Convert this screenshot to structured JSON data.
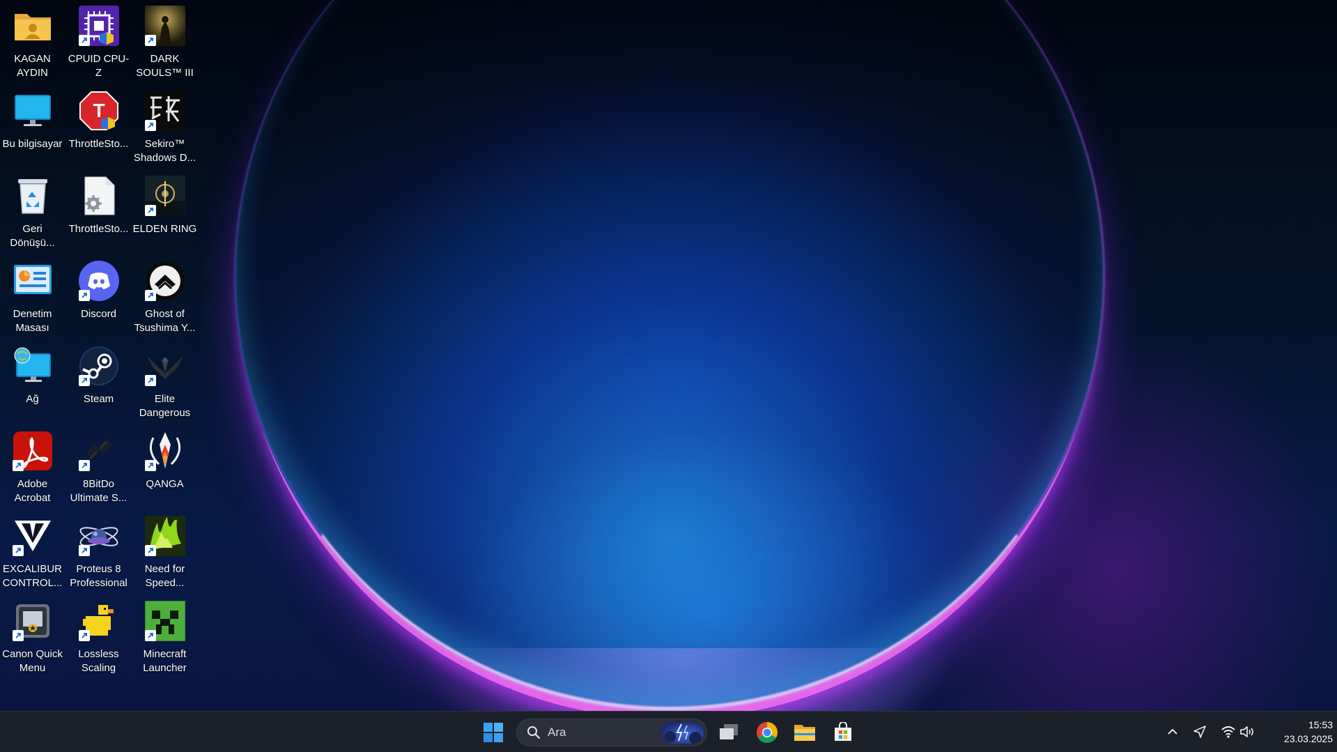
{
  "desktop": {
    "icons": [
      {
        "label": "KAGAN\nAYDIN",
        "icon": "user-folder-icon"
      },
      {
        "label": "Bu bilgisayar",
        "icon": "computer-icon"
      },
      {
        "label": "Geri\nDönüşü...",
        "icon": "recycle-bin-icon"
      },
      {
        "label": "Denetim\nMasası",
        "icon": "control-panel-icon"
      },
      {
        "label": "Ağ",
        "icon": "network-icon"
      },
      {
        "label": "Adobe\nAcrobat",
        "icon": "adobe-acrobat-icon"
      },
      {
        "label": "EXCALIBUR\nCONTROL...",
        "icon": "excalibur-icon"
      },
      {
        "label": "Canon Quick\nMenu",
        "icon": "canon-quick-menu-icon"
      },
      {
        "label": "CPUID CPU-Z",
        "icon": "cpuz-icon"
      },
      {
        "label": "ThrottleSto...",
        "icon": "throttlestop-icon"
      },
      {
        "label": "ThrottleSto...",
        "icon": "config-file-icon"
      },
      {
        "label": "Discord",
        "icon": "discord-icon"
      },
      {
        "label": "Steam",
        "icon": "steam-icon"
      },
      {
        "label": "8BitDo\nUltimate S...",
        "icon": "8bitdo-icon"
      },
      {
        "label": "Proteus 8\nProfessional",
        "icon": "proteus-icon"
      },
      {
        "label": "Lossless\nScaling",
        "icon": "lossless-scaling-icon"
      },
      {
        "label": "DARK\nSOULS™ III",
        "icon": "dark-souls-icon"
      },
      {
        "label": "Sekiro™\nShadows D...",
        "icon": "sekiro-icon"
      },
      {
        "label": "ELDEN RING",
        "icon": "elden-ring-icon"
      },
      {
        "label": "Ghost of\nTsushima Y...",
        "icon": "ghost-of-tsushima-icon"
      },
      {
        "label": "Elite\nDangerous",
        "icon": "elite-dangerous-icon"
      },
      {
        "label": "QANGA",
        "icon": "qanga-icon"
      },
      {
        "label": "Need for\nSpeed...",
        "icon": "need-for-speed-icon"
      },
      {
        "label": "Minecraft\nLauncher",
        "icon": "minecraft-icon"
      }
    ]
  },
  "taskbar": {
    "search": {
      "placeholder": "Ara"
    },
    "apps": [
      "start-icon",
      "task-view-icon",
      "chrome-icon",
      "file-explorer-icon",
      "microsoft-store-icon"
    ]
  },
  "tray": {
    "time": "15:53",
    "date": "23.03.2025"
  },
  "colors": {
    "taskbar_bg": "#1c2029",
    "accent": "#3a8ff7"
  }
}
